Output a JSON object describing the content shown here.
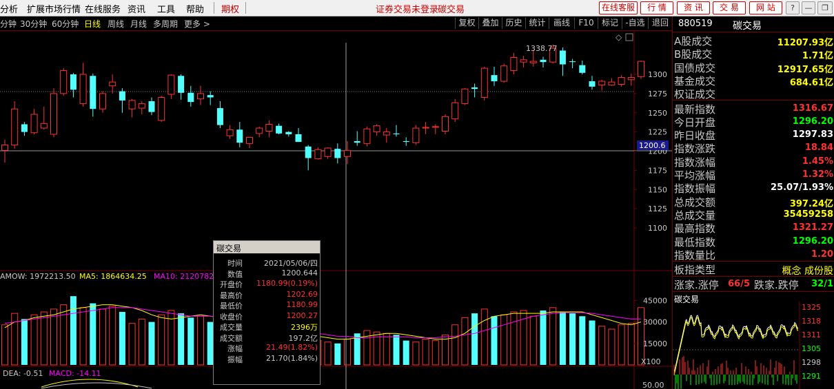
{
  "menubar": {
    "items": [
      "分析",
      "扩展市场行情",
      "在线服务",
      "资讯",
      "工具",
      "帮助"
    ],
    "active_item": "期权",
    "status_text": "证券交易未登录",
    "status_stock": "碳交易",
    "right_buttons": [
      "在线客服",
      "行 情",
      "资 讯",
      "交 易",
      "网 站"
    ],
    "window_buttons": [
      "?",
      "—",
      "❐",
      "✕"
    ]
  },
  "toolbar": {
    "periods": [
      "分钟",
      "30分钟",
      "60分钟",
      "日线",
      "周线",
      "月线",
      "多周期",
      "更多 >"
    ],
    "selected_period": "日线",
    "buttons": [
      "复权",
      "叠加",
      "历史",
      "统计",
      "画线",
      "F10",
      "标记",
      "-自选",
      "退回"
    ]
  },
  "chart": {
    "max_label": "1338.77",
    "crosshair_price": "1200.6",
    "price_ticks": [
      "1300",
      "1275",
      "1250",
      "1225",
      "1200",
      "1175",
      "1150",
      "1125",
      "1100"
    ],
    "volume_ticks": [
      "45000",
      "30000",
      "15000"
    ],
    "volume_unit": "X100",
    "volume_legend": {
      "amow": "AMOW: 1972213.50",
      "ma5": "MA5: 1864634.25",
      "ma10": "MA10: 2120782.0"
    },
    "macd_legend": {
      "dea": "DEA: -0.51",
      "macd": "MACD: -14.11"
    },
    "macd_tick": "50.00",
    "colors": {
      "up": "#ff3232",
      "down": "#54ffff",
      "ma5": "#ffff00",
      "ma10": "#ff00ff",
      "axis": "#7a0000"
    }
  },
  "chart_data": {
    "type": "candlestick",
    "ylim": [
      1090,
      1345
    ],
    "candles": [
      [
        1201,
        1215,
        1185,
        1208
      ],
      [
        1208,
        1265,
        1203,
        1255
      ],
      [
        1235,
        1238,
        1220,
        1225
      ],
      [
        1224,
        1255,
        1222,
        1248
      ],
      [
        1230,
        1258,
        1228,
        1236
      ],
      [
        1222,
        1282,
        1218,
        1275
      ],
      [
        1275,
        1308,
        1272,
        1305
      ],
      [
        1300,
        1302,
        1270,
        1280
      ],
      [
        1262,
        1315,
        1258,
        1300
      ],
      [
        1298,
        1301,
        1245,
        1255
      ],
      [
        1255,
        1278,
        1250,
        1275
      ],
      [
        1285,
        1300,
        1275,
        1290
      ],
      [
        1278,
        1282,
        1250,
        1266
      ],
      [
        1255,
        1268,
        1244,
        1266
      ],
      [
        1256,
        1265,
        1248,
        1262
      ],
      [
        1265,
        1270,
        1247,
        1251
      ],
      [
        1240,
        1272,
        1238,
        1270
      ],
      [
        1274,
        1300,
        1268,
        1299
      ],
      [
        1298,
        1300,
        1267,
        1276
      ],
      [
        1276,
        1285,
        1258,
        1264
      ],
      [
        1268,
        1285,
        1260,
        1275
      ],
      [
        1273,
        1278,
        1260,
        1270
      ],
      [
        1256,
        1265,
        1230,
        1234
      ],
      [
        1220,
        1234,
        1216,
        1228
      ],
      [
        1228,
        1238,
        1205,
        1211
      ],
      [
        1210,
        1217,
        1204,
        1218
      ],
      [
        1223,
        1232,
        1218,
        1230
      ],
      [
        1226,
        1240,
        1218,
        1235
      ],
      [
        1233,
        1236,
        1222,
        1223
      ],
      [
        1225,
        1226,
        1219,
        1222
      ],
      [
        1222,
        1230,
        1212,
        1212
      ],
      [
        1206,
        1208,
        1175,
        1191
      ],
      [
        1190,
        1205,
        1189,
        1202
      ],
      [
        1193,
        1205,
        1190,
        1204
      ],
      [
        1203,
        1210,
        1184,
        1191
      ],
      [
        1193,
        1213,
        1183,
        1201
      ],
      [
        1213,
        1226,
        1207,
        1211
      ],
      [
        1210,
        1232,
        1206,
        1229
      ],
      [
        1225,
        1235,
        1220,
        1233
      ],
      [
        1221,
        1230,
        1211,
        1225
      ],
      [
        1223,
        1234,
        1219,
        1222
      ],
      [
        1213,
        1218,
        1207,
        1212
      ],
      [
        1211,
        1234,
        1208,
        1230
      ],
      [
        1230,
        1238,
        1222,
        1231
      ],
      [
        1231,
        1235,
        1222,
        1232
      ],
      [
        1226,
        1248,
        1222,
        1245
      ],
      [
        1242,
        1268,
        1238,
        1263
      ],
      [
        1262,
        1282,
        1260,
        1281
      ],
      [
        1283,
        1288,
        1270,
        1281
      ],
      [
        1270,
        1310,
        1266,
        1308
      ],
      [
        1299,
        1310,
        1285,
        1291
      ],
      [
        1291,
        1314,
        1289,
        1311
      ],
      [
        1305,
        1328,
        1300,
        1322
      ],
      [
        1316,
        1324,
        1309,
        1319
      ],
      [
        1315,
        1332,
        1310,
        1317
      ],
      [
        1319,
        1323,
        1309,
        1316
      ],
      [
        1316,
        1339,
        1314,
        1334
      ],
      [
        1331,
        1335,
        1298,
        1313
      ],
      [
        1317,
        1320,
        1308,
        1316
      ],
      [
        1312,
        1318,
        1300,
        1302
      ],
      [
        1291,
        1298,
        1280,
        1284
      ],
      [
        1286,
        1293,
        1279,
        1291
      ],
      [
        1286,
        1295,
        1285,
        1290
      ],
      [
        1287,
        1299,
        1284,
        1296
      ],
      [
        1293,
        1301,
        1285,
        1296
      ],
      [
        1297,
        1318,
        1294,
        1317
      ]
    ],
    "volumes": [
      28000,
      36000,
      32000,
      35000,
      37000,
      39000,
      42000,
      48000,
      40000,
      43000,
      39000,
      41000,
      37000,
      29000,
      32000,
      30000,
      35000,
      38000,
      36000,
      33000,
      34000,
      30000,
      29000,
      24000,
      20000,
      22000,
      24000,
      23000,
      21000,
      19000,
      20000,
      18000,
      17000,
      16000,
      15000,
      18000,
      22000,
      24000,
      23000,
      22000,
      21000,
      17000,
      16000,
      18000,
      17000,
      21000,
      28000,
      33000,
      36000,
      39000,
      34000,
      35000,
      37000,
      38000,
      34000,
      38000,
      40000,
      37000,
      36000,
      34000,
      31000,
      27000,
      25000,
      28000,
      29000,
      40000
    ],
    "ma5": [
      26000,
      30000,
      31000,
      33000,
      34000,
      35000,
      37000,
      39000,
      40000,
      41000,
      42000,
      42000,
      41000,
      40000,
      38000,
      35000,
      33000,
      32000,
      33000,
      34000,
      35000,
      34000,
      33000,
      31000,
      28000,
      26000,
      24000,
      23000,
      22000,
      21000,
      21000,
      20000,
      20000,
      19000,
      18000,
      18000,
      19000,
      20000,
      21000,
      22000,
      22000,
      21000,
      20000,
      19000,
      18000,
      18000,
      19000,
      22000,
      27000,
      31000,
      34000,
      35000,
      36000,
      36000,
      36000,
      36000,
      37000,
      37000,
      37000,
      37000,
      35000,
      33000,
      31000,
      29000,
      28000,
      30000
    ],
    "ma10": [
      29000,
      30000,
      31000,
      32000,
      33000,
      34000,
      35000,
      36000,
      37000,
      38000,
      39000,
      40000,
      40000,
      40000,
      39000,
      38000,
      37000,
      36000,
      35000,
      34000,
      34000,
      34000,
      33000,
      32000,
      31000,
      30000,
      29000,
      28000,
      27000,
      26000,
      25000,
      23000,
      22000,
      21000,
      20000,
      20000,
      19000,
      19000,
      19500,
      19500,
      19500,
      19500,
      19000,
      19000,
      19000,
      19500,
      20000,
      21000,
      22000,
      24000,
      26000,
      28000,
      30000,
      32000,
      34000,
      35000,
      36000,
      36500,
      36500,
      36500,
      36000,
      35000,
      34000,
      33000,
      32000,
      32000
    ],
    "volume_ylim": [
      0,
      50000
    ]
  },
  "popup": {
    "title": "碳交易",
    "rows": [
      {
        "label": "时间",
        "value": "2021/05/06/四",
        "color": "#c8c8c8"
      },
      {
        "label": "数值",
        "value": "1200.644",
        "color": "#c8c8c8"
      },
      {
        "label": "开盘价",
        "value": "1180.99(0.19%)",
        "color": "#ff3232"
      },
      {
        "label": "最高价",
        "value": "1202.69",
        "color": "#ff3232"
      },
      {
        "label": "最低价",
        "value": "1180.99",
        "color": "#ff3232"
      },
      {
        "label": "收盘价",
        "value": "1200.27",
        "color": "#ff3232"
      },
      {
        "label": "成交量",
        "value": "2396万",
        "color": "#ffff00"
      },
      {
        "label": "成交额",
        "value": "197.2亿",
        "color": "#c8c8c8"
      },
      {
        "label": "涨幅",
        "value": "21.49(1.82%)",
        "color": "#ff3232"
      },
      {
        "label": "振幅",
        "value": "21.70(1.84%)",
        "color": "#c8c8c8"
      }
    ]
  },
  "panel": {
    "code": "880519",
    "name": "碳交易",
    "rows": [
      {
        "label": "A股成交",
        "value": "11207.93亿",
        "color": "#ffff00"
      },
      {
        "label": "B股成交",
        "value": "1.71亿",
        "color": "#ffff00"
      },
      {
        "label": "国债成交",
        "value": "12917.65亿",
        "color": "#ffff00"
      },
      {
        "label": "基金成交",
        "value": "684.61亿",
        "color": "#ffff00"
      },
      {
        "label": "权证成交",
        "value": "",
        "color": "#ffff00"
      },
      {
        "label": "最新指数",
        "value": "1316.67",
        "color": "#ff3232"
      },
      {
        "label": "今日开盘",
        "value": "1296.20",
        "color": "#00ff00"
      },
      {
        "label": "昨日收盘",
        "value": "1297.83",
        "color": "#ffffff"
      },
      {
        "label": "指数涨跌",
        "value": "18.84",
        "color": "#ff3232"
      },
      {
        "label": "指数涨幅",
        "value": "1.45%",
        "color": "#ff3232"
      },
      {
        "label": "平均涨幅",
        "value": "1.32%",
        "color": "#ff3232"
      },
      {
        "label": "指数振幅",
        "value": "25.07/1.93%",
        "color": "#ffffff"
      },
      {
        "label": "总成交额",
        "value": "397.24亿",
        "color": "#ffff00"
      },
      {
        "label": "总成交量",
        "value": "35459258",
        "color": "#ffff00"
      },
      {
        "label": "最高指数",
        "value": "1321.27",
        "color": "#ff3232"
      },
      {
        "label": "最低指数",
        "value": "1296.20",
        "color": "#00ff00"
      },
      {
        "label": "指数量比",
        "value": "1.20",
        "color": "#ff3232"
      }
    ],
    "type_label": "板指类型",
    "type_value": "概念 成份股",
    "breadth": {
      "up_label": "涨家.涨停",
      "up_value": "66/5",
      "down_label": "跌家.跌停",
      "down_value": "32/1"
    },
    "mini_title": "碳交易",
    "mini_ticks": [
      "1325",
      "1318",
      "1311",
      "1305",
      "1298",
      "1291"
    ]
  }
}
